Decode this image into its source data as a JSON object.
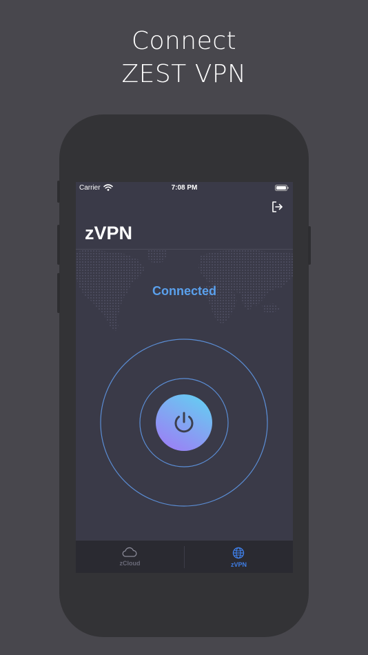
{
  "promo": {
    "line1": "Connect",
    "line2": "ZEST VPN"
  },
  "status_bar": {
    "carrier": "Carrier",
    "time": "7:08 PM"
  },
  "header": {
    "title": "zVPN",
    "logout_icon": "logout-icon"
  },
  "main": {
    "connection_status": "Connected",
    "status_color": "#5aa0ec",
    "power_icon": "power-icon"
  },
  "tabs": [
    {
      "label": "zCloud",
      "icon": "cloud-icon",
      "selected": false
    },
    {
      "label": "zVPN",
      "icon": "globe-icon",
      "selected": true
    }
  ],
  "colors": {
    "background": "#48474d",
    "device": "#333336",
    "screen": "#3a3a48",
    "accent": "#3f7ee6",
    "ring": "#5b8ed6"
  }
}
